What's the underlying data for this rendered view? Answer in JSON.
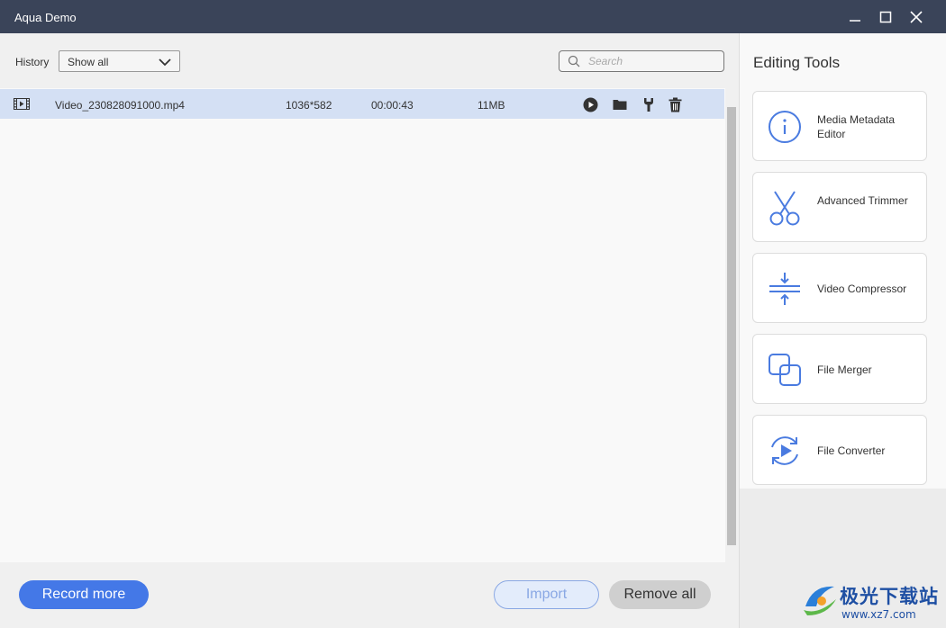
{
  "window": {
    "title": "Aqua Demo",
    "controls": [
      "minimize-icon",
      "maximize-icon",
      "close-icon"
    ]
  },
  "toolbar": {
    "history_label": "History",
    "filter_value": "Show all",
    "search_placeholder": "Search"
  },
  "recordings": [
    {
      "filename": "Video_230828091000.mp4",
      "resolution": "1036*582",
      "duration": "00:00:43",
      "size": "11MB",
      "file_icon": "film-icon",
      "actions": [
        "play-icon",
        "folder-icon",
        "wrench-icon",
        "trash-icon"
      ]
    }
  ],
  "sidebar": {
    "title": "Editing Tools",
    "tools": [
      {
        "label": "Media Metadata Editor",
        "icon": "info-icon"
      },
      {
        "label": "Advanced Trimmer",
        "icon": "scissors-icon"
      },
      {
        "label": "Video Compressor",
        "icon": "compress-icon"
      },
      {
        "label": "File Merger",
        "icon": "merge-icon"
      },
      {
        "label": "File Converter",
        "icon": "convert-icon"
      }
    ]
  },
  "buttons": {
    "record_more": "Record more",
    "import": "Import",
    "remove_all": "Remove all"
  },
  "watermark": {
    "text": "极光下载站",
    "url": "www.xz7.com"
  },
  "colors": {
    "titlebar": "#3a4459",
    "accent": "#4478e7",
    "selected_row": "#d4e0f4",
    "tool_icon": "#4a7be0"
  }
}
